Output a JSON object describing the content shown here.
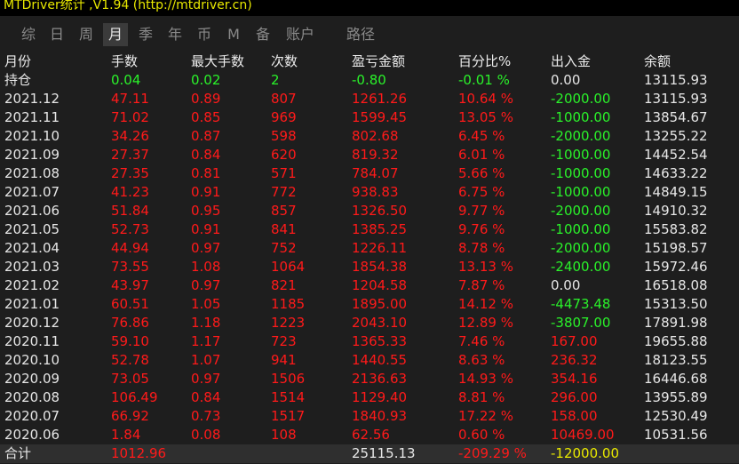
{
  "title": "MTDriver统计 ,V1.94 (http://mtdriver.cn)",
  "tabs": [
    "综",
    "日",
    "周",
    "月",
    "季",
    "年",
    "币",
    "M",
    "备",
    "账户",
    "路径"
  ],
  "active_tab": 3,
  "columns": [
    "月份",
    "手数",
    "最大手数",
    "次数",
    "盈亏金额",
    "百分比%",
    "出入金",
    "余额"
  ],
  "holding": {
    "label": "持仓",
    "lots": "0.04",
    "max_lots": "0.02",
    "count": "2",
    "pnl": "-0.80",
    "pct": "-0.01 %",
    "flow": "0.00",
    "balance": "13115.93"
  },
  "rows": [
    {
      "month": "2021.12",
      "lots": "47.11",
      "max_lots": "0.89",
      "count": "807",
      "pnl": "1261.26",
      "pct": "10.64 %",
      "flow": "-2000.00",
      "balance": "13115.93"
    },
    {
      "month": "2021.11",
      "lots": "71.02",
      "max_lots": "0.85",
      "count": "969",
      "pnl": "1599.45",
      "pct": "13.05 %",
      "flow": "-1000.00",
      "balance": "13854.67"
    },
    {
      "month": "2021.10",
      "lots": "34.26",
      "max_lots": "0.87",
      "count": "598",
      "pnl": "802.68",
      "pct": "6.45 %",
      "flow": "-2000.00",
      "balance": "13255.22"
    },
    {
      "month": "2021.09",
      "lots": "27.37",
      "max_lots": "0.84",
      "count": "620",
      "pnl": "819.32",
      "pct": "6.01 %",
      "flow": "-1000.00",
      "balance": "14452.54"
    },
    {
      "month": "2021.08",
      "lots": "27.35",
      "max_lots": "0.81",
      "count": "571",
      "pnl": "784.07",
      "pct": "5.66 %",
      "flow": "-1000.00",
      "balance": "14633.22"
    },
    {
      "month": "2021.07",
      "lots": "41.23",
      "max_lots": "0.91",
      "count": "772",
      "pnl": "938.83",
      "pct": "6.75 %",
      "flow": "-1000.00",
      "balance": "14849.15"
    },
    {
      "month": "2021.06",
      "lots": "51.84",
      "max_lots": "0.95",
      "count": "857",
      "pnl": "1326.50",
      "pct": "9.77 %",
      "flow": "-2000.00",
      "balance": "14910.32"
    },
    {
      "month": "2021.05",
      "lots": "52.73",
      "max_lots": "0.91",
      "count": "841",
      "pnl": "1385.25",
      "pct": "9.76 %",
      "flow": "-1000.00",
      "balance": "15583.82"
    },
    {
      "month": "2021.04",
      "lots": "44.94",
      "max_lots": "0.97",
      "count": "752",
      "pnl": "1226.11",
      "pct": "8.78 %",
      "flow": "-2000.00",
      "balance": "15198.57"
    },
    {
      "month": "2021.03",
      "lots": "73.55",
      "max_lots": "1.08",
      "count": "1064",
      "pnl": "1854.38",
      "pct": "13.13 %",
      "flow": "-2400.00",
      "balance": "15972.46"
    },
    {
      "month": "2021.02",
      "lots": "43.97",
      "max_lots": "0.97",
      "count": "821",
      "pnl": "1204.58",
      "pct": "7.87 %",
      "flow": "0.00",
      "balance": "16518.08"
    },
    {
      "month": "2021.01",
      "lots": "60.51",
      "max_lots": "1.05",
      "count": "1185",
      "pnl": "1895.00",
      "pct": "14.12 %",
      "flow": "-4473.48",
      "balance": "15313.50"
    },
    {
      "month": "2020.12",
      "lots": "76.86",
      "max_lots": "1.18",
      "count": "1223",
      "pnl": "2043.10",
      "pct": "12.89 %",
      "flow": "-3807.00",
      "balance": "17891.98"
    },
    {
      "month": "2020.11",
      "lots": "59.10",
      "max_lots": "1.17",
      "count": "723",
      "pnl": "1365.33",
      "pct": "7.46 %",
      "flow": "167.00",
      "balance": "19655.88"
    },
    {
      "month": "2020.10",
      "lots": "52.78",
      "max_lots": "1.07",
      "count": "941",
      "pnl": "1440.55",
      "pct": "8.63 %",
      "flow": "236.32",
      "balance": "18123.55"
    },
    {
      "month": "2020.09",
      "lots": "73.05",
      "max_lots": "0.97",
      "count": "1506",
      "pnl": "2136.63",
      "pct": "14.93 %",
      "flow": "354.16",
      "balance": "16446.68"
    },
    {
      "month": "2020.08",
      "lots": "106.49",
      "max_lots": "0.84",
      "count": "1514",
      "pnl": "1129.40",
      "pct": "8.81 %",
      "flow": "296.00",
      "balance": "13955.89"
    },
    {
      "month": "2020.07",
      "lots": "66.92",
      "max_lots": "0.73",
      "count": "1517",
      "pnl": "1840.93",
      "pct": "17.22 %",
      "flow": "158.00",
      "balance": "12530.49"
    },
    {
      "month": "2020.06",
      "lots": "1.84",
      "max_lots": "0.08",
      "count": "108",
      "pnl": "62.56",
      "pct": "0.60 %",
      "flow": "10469.00",
      "balance": "10531.56"
    }
  ],
  "total": {
    "label": "合计",
    "lots": "1012.96",
    "pnl": "25115.13",
    "pct": "-209.29 %",
    "flow": "-12000.00"
  },
  "colors": {
    "positive": "#ff1a1a",
    "negative": "#2af22a",
    "neutral": "#e6e6e6",
    "title": "#e8e800",
    "background": "#1e1e1e"
  }
}
